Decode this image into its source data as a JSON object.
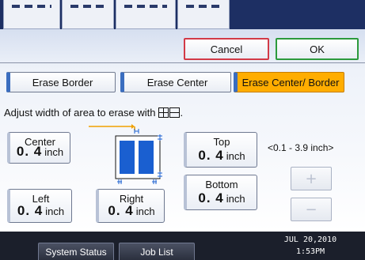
{
  "buttons": {
    "cancel": "Cancel",
    "ok": "OK"
  },
  "tabs": [
    {
      "label": "Erase Border",
      "selected": false
    },
    {
      "label": "Erase Center",
      "selected": false
    },
    {
      "label": "Erase Center/ Border",
      "selected": true
    }
  ],
  "instruction": "Adjust width of area to erase with",
  "fields": {
    "center": {
      "label": "Center",
      "value": "0. 4",
      "unit": "inch"
    },
    "top": {
      "label": "Top",
      "value": "0. 4",
      "unit": "inch"
    },
    "bottom": {
      "label": "Bottom",
      "value": "0. 4",
      "unit": "inch"
    },
    "left": {
      "label": "Left",
      "value": "0. 4",
      "unit": "inch"
    },
    "right": {
      "label": "Right",
      "value": "0. 4",
      "unit": "inch"
    }
  },
  "range": "<0.1 - 3.9 inch>",
  "stepper": {
    "plus": "+",
    "minus": "−"
  },
  "status_bar": {
    "system_status": "System Status",
    "job_list": "Job List",
    "date": "JUL  20,2010",
    "time": "1:53PM"
  },
  "colors": {
    "selected_tab": "#ffad00",
    "cancel_border": "#d23a47",
    "ok_border": "#2c9a3c",
    "header": "#1d2f63",
    "status_bar": "#1b1f2b"
  },
  "icons": [
    "erase-area-icons",
    "erase-diagram-icon"
  ]
}
